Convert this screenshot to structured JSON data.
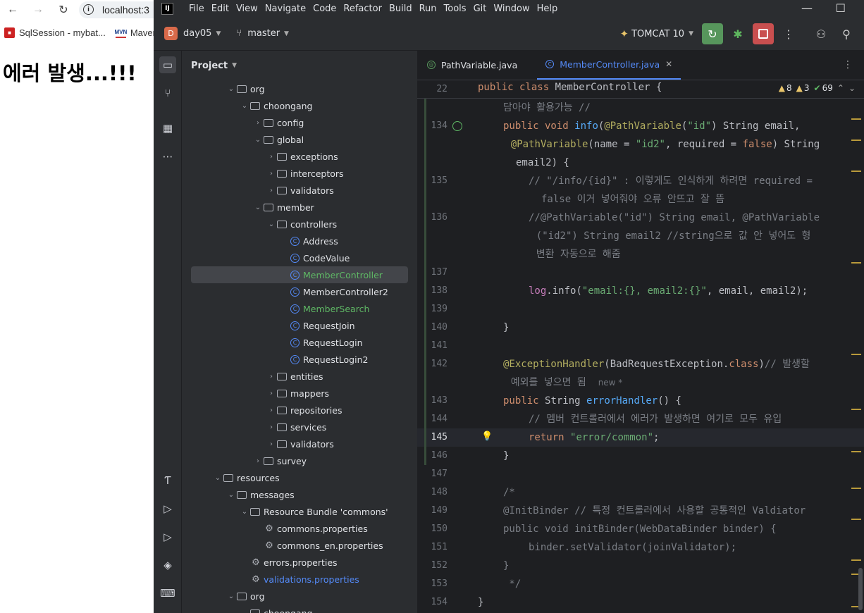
{
  "browser": {
    "url": "localhost:3",
    "bookmarks": [
      {
        "label": "SqlSession - mybat..."
      },
      {
        "label": "Maven"
      }
    ],
    "heading": "에러 발생...!!!"
  },
  "ide": {
    "menu": [
      "File",
      "Edit",
      "View",
      "Navigate",
      "Code",
      "Refactor",
      "Build",
      "Run",
      "Tools",
      "Git",
      "Window",
      "Help"
    ],
    "project_badge": "D",
    "project_name": "day05",
    "branch": "master",
    "run_config": "TOMCAT 10",
    "panel_title": "Project",
    "tree": [
      {
        "label": "org",
        "depth": 4,
        "type": "folder",
        "open": true
      },
      {
        "label": "choongang",
        "depth": 5,
        "type": "folder",
        "open": true
      },
      {
        "label": "config",
        "depth": 6,
        "type": "folder",
        "open": false
      },
      {
        "label": "global",
        "depth": 6,
        "type": "folder",
        "open": true
      },
      {
        "label": "exceptions",
        "depth": 7,
        "type": "folder",
        "open": false
      },
      {
        "label": "interceptors",
        "depth": 7,
        "type": "folder",
        "open": false
      },
      {
        "label": "validators",
        "depth": 7,
        "type": "folder",
        "open": false
      },
      {
        "label": "member",
        "depth": 6,
        "type": "folder",
        "open": true
      },
      {
        "label": "controllers",
        "depth": 7,
        "type": "folder",
        "open": true
      },
      {
        "label": "Address",
        "depth": 8,
        "type": "class"
      },
      {
        "label": "CodeValue",
        "depth": 8,
        "type": "class"
      },
      {
        "label": "MemberController",
        "depth": 8,
        "type": "class",
        "selected": true,
        "color": "green"
      },
      {
        "label": "MemberController2",
        "depth": 8,
        "type": "class"
      },
      {
        "label": "MemberSearch",
        "depth": 8,
        "type": "class",
        "color": "green"
      },
      {
        "label": "RequestJoin",
        "depth": 8,
        "type": "class"
      },
      {
        "label": "RequestLogin",
        "depth": 8,
        "type": "class"
      },
      {
        "label": "RequestLogin2",
        "depth": 8,
        "type": "class"
      },
      {
        "label": "entities",
        "depth": 7,
        "type": "folder",
        "open": false
      },
      {
        "label": "mappers",
        "depth": 7,
        "type": "folder",
        "open": false
      },
      {
        "label": "repositories",
        "depth": 7,
        "type": "folder",
        "open": false
      },
      {
        "label": "services",
        "depth": 7,
        "type": "folder",
        "open": false
      },
      {
        "label": "validators",
        "depth": 7,
        "type": "folder",
        "open": false
      },
      {
        "label": "survey",
        "depth": 6,
        "type": "folder",
        "open": false
      },
      {
        "label": "resources",
        "depth": 3,
        "type": "folder",
        "open": true
      },
      {
        "label": "messages",
        "depth": 4,
        "type": "folder",
        "open": true
      },
      {
        "label": "Resource Bundle 'commons'",
        "depth": 5,
        "type": "bundle",
        "open": true
      },
      {
        "label": "commons.properties",
        "depth": 6,
        "type": "props"
      },
      {
        "label": "commons_en.properties",
        "depth": 6,
        "type": "props"
      },
      {
        "label": "errors.properties",
        "depth": 5,
        "type": "props"
      },
      {
        "label": "validations.properties",
        "depth": 5,
        "type": "props",
        "color": "blue"
      },
      {
        "label": "org",
        "depth": 4,
        "type": "folder",
        "open": true
      },
      {
        "label": "choongang",
        "depth": 5,
        "type": "folder",
        "open": true
      }
    ],
    "tabs": [
      {
        "label": "PathVariable.java",
        "active": false
      },
      {
        "label": "MemberController.java",
        "active": true
      }
    ],
    "inspections": {
      "warnings": "8",
      "weak_warnings": "3",
      "ok": "69"
    },
    "sticky_line": {
      "num": "22",
      "text": "public class MemberController {"
    },
    "code": [
      {
        "num": "",
        "html": "<span class='cm'>담아야 활용가능 //</span>",
        "indent": 1
      },
      {
        "num": "134",
        "html": "<span class='kw'>public void </span><span class='fn'>info</span>(<span class='an'>@PathVariable</span>(<span class='str'>\"id\"</span>) String email,",
        "indent": 1
      },
      {
        "num": "",
        "html": "<span class='an'>@PathVariable</span>(name = <span class='str'>\"id2\"</span>, required = <span class='kw'>false</span>) String",
        "indent": 1.3
      },
      {
        "num": "",
        "html": "email2) {",
        "indent": 1.5
      },
      {
        "num": "135",
        "html": "<span class='cm'>// \"/info/{id}\" : 이렇게도 인식하게 하려면 required =</span>",
        "indent": 2
      },
      {
        "num": "",
        "html": "<span class='cm'>false 이거 넣어줘야 오류 안뜨고 잘 뜸</span>",
        "indent": 2.5
      },
      {
        "num": "136",
        "html": "<span class='cm'>//@PathVariable(\"id\") String email, @PathVariable</span>",
        "indent": 2
      },
      {
        "num": "",
        "html": "<span class='cm'>(\"id2\") String email2 //string으로 값 안 넣어도 형</span>",
        "indent": 2.3
      },
      {
        "num": "",
        "html": "<span class='cm'>변환 자동으로 해줌</span>",
        "indent": 2.3
      },
      {
        "num": "137",
        "html": "",
        "indent": 0
      },
      {
        "num": "138",
        "html": "<span class='pl'>log</span>.info(<span class='str'>\"email:{}, email2:{}\"</span>, email, email2);",
        "indent": 2
      },
      {
        "num": "139",
        "html": "",
        "indent": 0
      },
      {
        "num": "140",
        "html": "}",
        "indent": 1
      },
      {
        "num": "141",
        "html": "",
        "indent": 0
      },
      {
        "num": "142",
        "html": "<span class='an'>@ExceptionHandler</span>(BadRequestException.<span class='kw'>class</span>)<span class='cm'>// 발생할</span>",
        "indent": 1
      },
      {
        "num": "",
        "html": "<span class='cm'>예외를 넣으면 됨</span>  <span class='inlay'>new *</span>",
        "indent": 1.3
      },
      {
        "num": "143",
        "html": "<span class='kw'>public </span>String <span class='fn'>errorHandler</span>() {",
        "indent": 1
      },
      {
        "num": "144",
        "html": "<span class='cm'>// 멤버 컨트롤러에서 에러가 발생하면 여기로 모두 유입</span>",
        "indent": 2
      },
      {
        "num": "145",
        "html": "<span class='kw'>return </span><span class='str'>\"error/common\"</span>;",
        "indent": 2,
        "current": true
      },
      {
        "num": "146",
        "html": "}",
        "indent": 1
      },
      {
        "num": "147",
        "html": "",
        "indent": 0
      },
      {
        "num": "148",
        "html": "<span class='cm'>/*</span>",
        "indent": 1
      },
      {
        "num": "149",
        "html": "<span class='cm'>@InitBinder // 특정 컨트롤러에서 사용할 공통적인 Valdiator</span>",
        "indent": 1
      },
      {
        "num": "150",
        "html": "<span class='cm'>public void initBinder(WebDataBinder binder) {</span>",
        "indent": 1
      },
      {
        "num": "151",
        "html": "<span class='cm'>binder.setValidator(joinValidator);</span>",
        "indent": 2
      },
      {
        "num": "152",
        "html": "<span class='cm'>}</span>",
        "indent": 1
      },
      {
        "num": "153",
        "html": "<span class='cm'> */</span>",
        "indent": 1
      },
      {
        "num": "154",
        "html": "}",
        "indent": 0
      }
    ]
  }
}
